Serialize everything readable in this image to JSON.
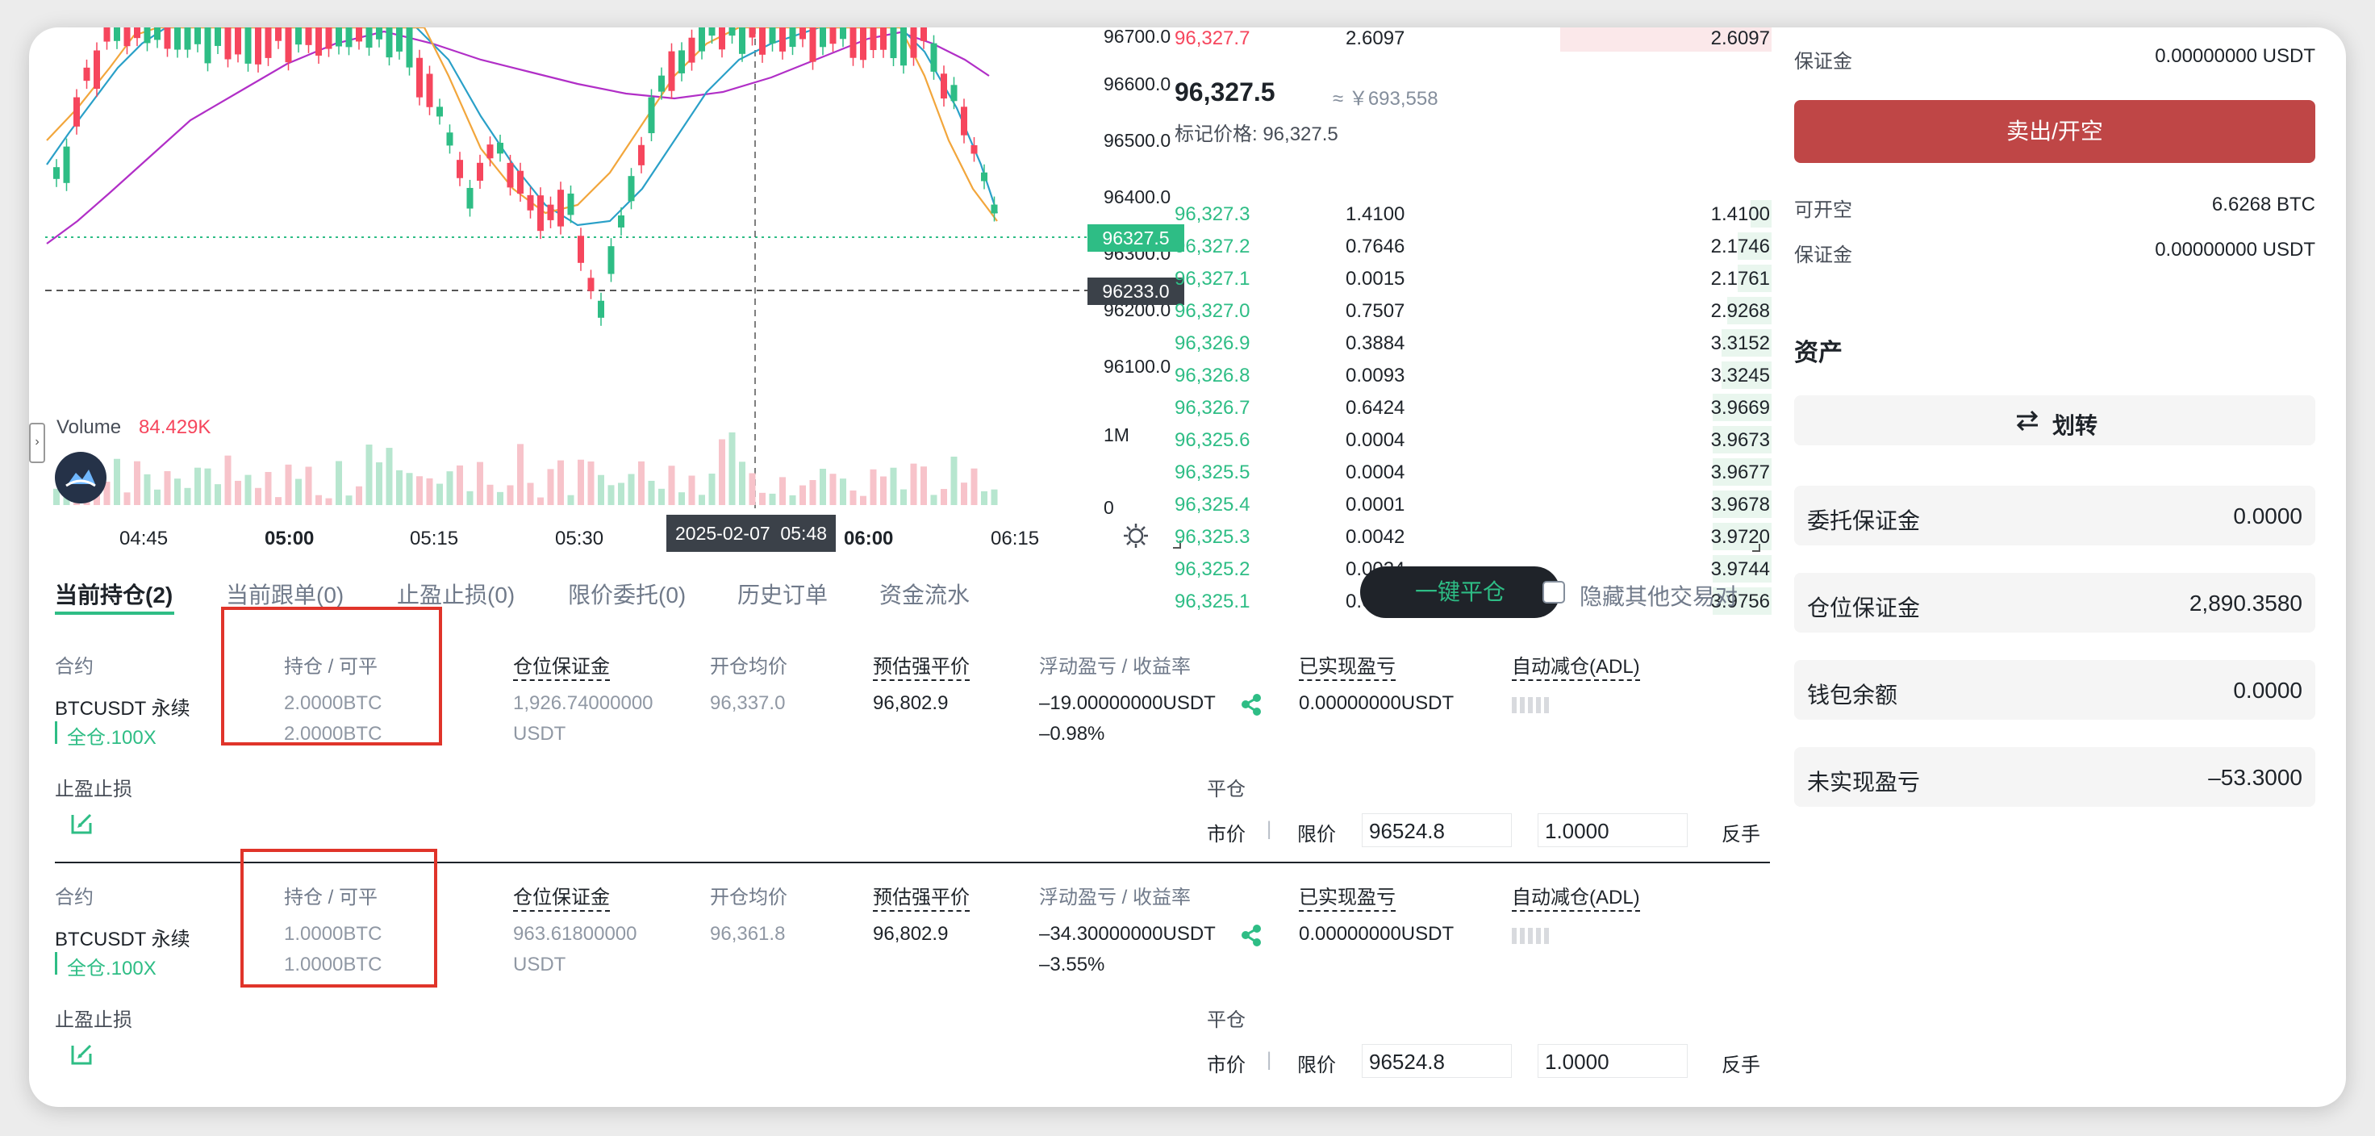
{
  "chart": {
    "y_ticks": [
      "96700.0",
      "96600.0",
      "96500.0",
      "96400.0",
      "96300.0",
      "96200.0",
      "96100.0"
    ],
    "last_price_tag": "96327.5",
    "cursor_price_tag": "96233.0",
    "x_ticks": [
      "04:45",
      "05:00",
      "05:15",
      "05:30",
      "06:00",
      "06:15"
    ],
    "cursor_time": "2025-02-07  05:48",
    "volume_label": "Volume",
    "volume_value": "84.429K",
    "volume_ticks": [
      "1M",
      "0"
    ]
  },
  "orderbook": {
    "top_ask": {
      "price": "96,327.7",
      "amount": "2.6097",
      "total": "2.6097"
    },
    "last_price": "96,327.5",
    "approx": "≈ ￥693,558",
    "mark_label": "标记价格: 96,327.5",
    "bids": [
      {
        "price": "96,327.3",
        "amount": "1.4100",
        "total": "1.4100",
        "depth": 0.1
      },
      {
        "price": "96,327.2",
        "amount": "0.7646",
        "total": "2.1746",
        "depth": 0.16
      },
      {
        "price": "96,327.1",
        "amount": "0.0015",
        "total": "2.1761",
        "depth": 0.16
      },
      {
        "price": "96,327.0",
        "amount": "0.7507",
        "total": "2.9268",
        "depth": 0.21
      },
      {
        "price": "96,326.9",
        "amount": "0.3884",
        "total": "3.3152",
        "depth": 0.24
      },
      {
        "price": "96,326.8",
        "amount": "0.0093",
        "total": "3.3245",
        "depth": 0.24
      },
      {
        "price": "96,326.7",
        "amount": "0.6424",
        "total": "3.9669",
        "depth": 0.28
      },
      {
        "price": "96,325.6",
        "amount": "0.0004",
        "total": "3.9673",
        "depth": 0.28
      },
      {
        "price": "96,325.5",
        "amount": "0.0004",
        "total": "3.9677",
        "depth": 0.28
      },
      {
        "price": "96,325.4",
        "amount": "0.0001",
        "total": "3.9678",
        "depth": 0.28
      },
      {
        "price": "96,325.3",
        "amount": "0.0042",
        "total": "3.9720",
        "depth": 0.28
      },
      {
        "price": "96,325.2",
        "amount": "0.0024",
        "total": "3.9744",
        "depth": 0.28
      },
      {
        "price": "96,325.1",
        "amount": "0.0012",
        "total": "3.9756",
        "depth": 0.28
      }
    ]
  },
  "tabs": [
    "当前持仓(2)",
    "当前跟单(0)",
    "止盈止损(0)",
    "限价委托(0)",
    "历史订单",
    "资金流水"
  ],
  "close_all_label": "一键平仓",
  "hide_others_label": "隐藏其他交易对",
  "columns": {
    "contract": "合约",
    "hold": "持仓 / 可平",
    "margin": "仓位保证金",
    "entry": "开仓均价",
    "liq": "预估强平价",
    "pnl": "浮动盈亏 / 收益率",
    "realized": "已实现盈亏",
    "adl": "自动减仓(ADL)"
  },
  "tpsl_label": "止盈止损",
  "close_label": "平仓",
  "market_label": "市价",
  "divider": "|",
  "limit_label": "限价",
  "reverse_label": "反手",
  "positions": [
    {
      "symbol": "BTCUSDT 永续",
      "mode": "全仓.100X",
      "hold": "2.0000BTC",
      "closable": "2.0000BTC",
      "margin": "1,926.74000000",
      "margin_unit": "USDT",
      "entry": "96,337.0",
      "liq": "96,802.9",
      "pnl": "–19.00000000USDT",
      "roe": "–0.98%",
      "realized": "0.00000000USDT",
      "limit_price": "96524.8",
      "qty": "1.0000"
    },
    {
      "symbol": "BTCUSDT 永续",
      "mode": "全仓.100X",
      "hold": "1.0000BTC",
      "closable": "1.0000BTC",
      "margin": "963.61800000",
      "margin_unit": "USDT",
      "entry": "96,361.8",
      "liq": "96,802.9",
      "pnl": "–34.30000000USDT",
      "roe": "–3.55%",
      "realized": "0.00000000USDT",
      "limit_price": "96524.8",
      "qty": "1.0000"
    }
  ],
  "right_panel": {
    "margin_label": "保证金",
    "margin_val": "0.00000000 USDT",
    "sell_button": "卖出/开空",
    "openable_label": "可开空",
    "openable_val": "6.6268 BTC",
    "margin2_label": "保证金",
    "margin2_val": "0.00000000 USDT",
    "assets_title": "资产",
    "transfer_label": "划转",
    "asset_rows": [
      {
        "k": "委托保证金",
        "v": "0.0000"
      },
      {
        "k": "仓位保证金",
        "v": "2,890.3580"
      },
      {
        "k": "钱包余额",
        "v": "0.0000"
      },
      {
        "k": "未实现盈亏",
        "v": "–53.3000"
      }
    ]
  },
  "colors": {
    "up": "#2ebd85",
    "down": "#f6465d",
    "sell": "#bf4646",
    "close_all_bg": "#1f2329"
  }
}
